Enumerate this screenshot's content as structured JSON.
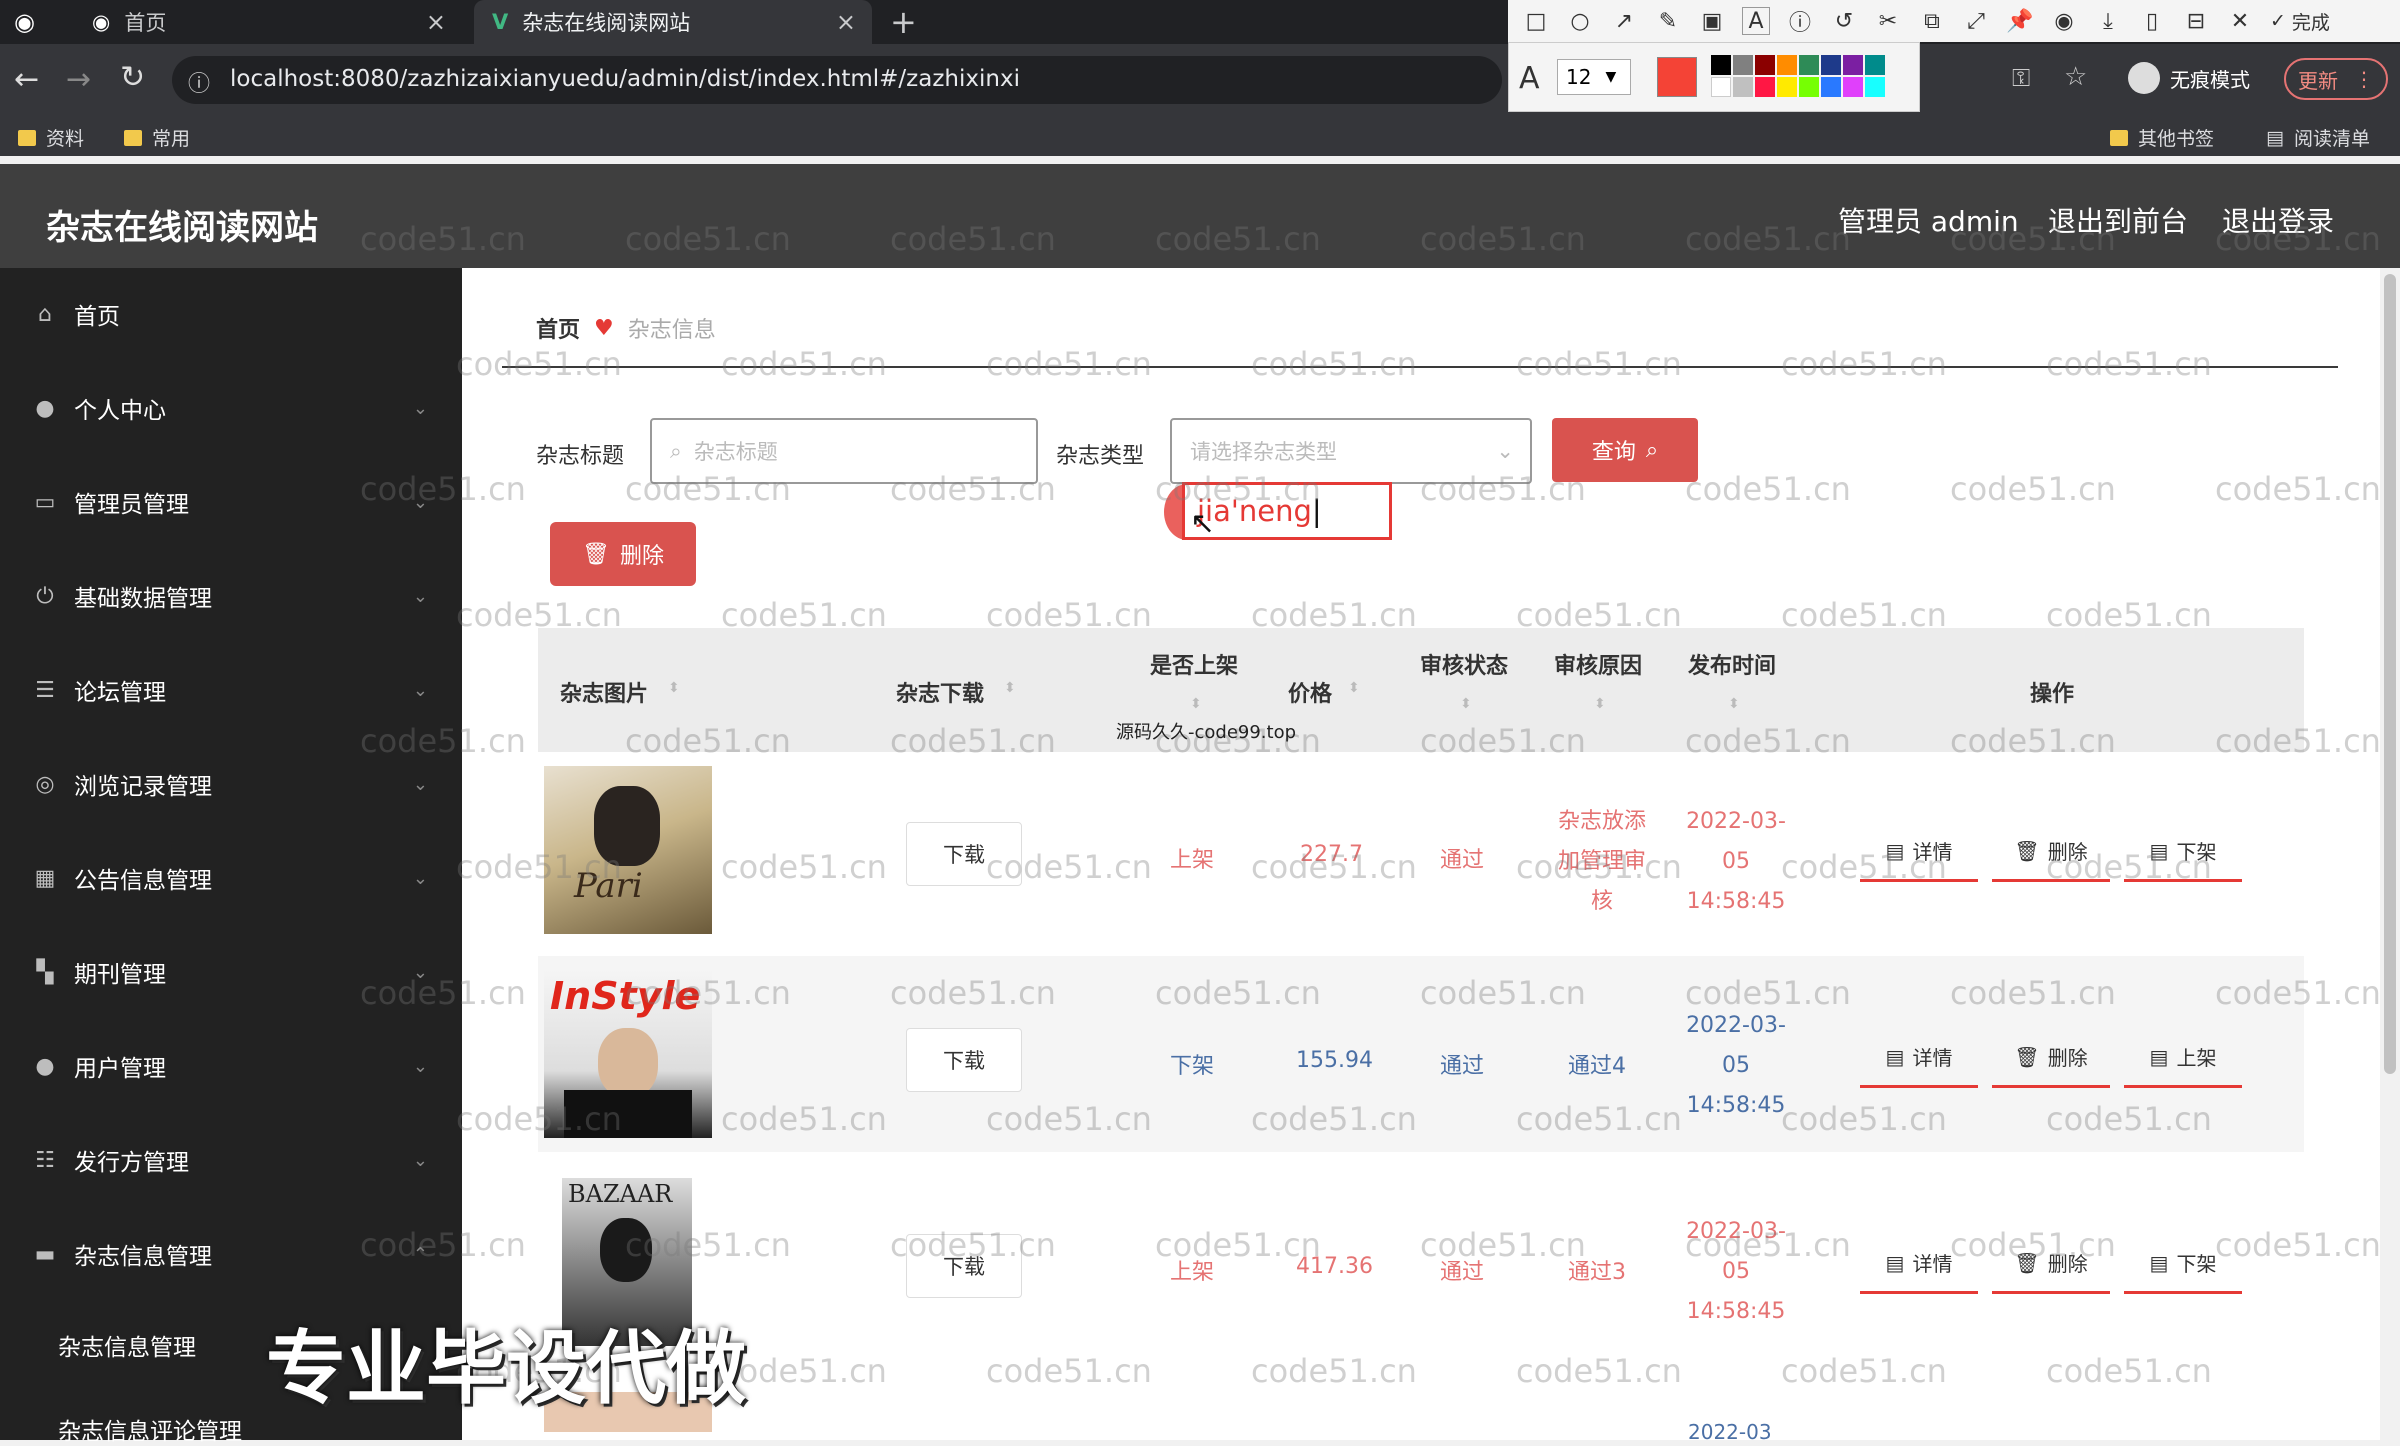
{
  "browser": {
    "tabs": [
      {
        "label": "首页",
        "active": false
      },
      {
        "label": "杂志在线阅读网站",
        "active": true
      }
    ],
    "url": "localhost:8080/zazhizaixianyuedu/admin/dist/index.html#/zazhixinxi",
    "bookmarks": [
      "资料",
      "常用"
    ],
    "bookmarks_right": [
      "其他书签",
      "阅读清单"
    ],
    "incognito_label": "无痕模式",
    "update_label": "更新",
    "annot_font_size": "12",
    "annot_done": "完成"
  },
  "header": {
    "title": "杂志在线阅读网站",
    "admin_label": "管理员 admin",
    "to_front": "退出到前台",
    "logout": "退出登录"
  },
  "sidebar": {
    "items": [
      {
        "label": "首页",
        "icon": "home-icon"
      },
      {
        "label": "个人中心",
        "icon": "user-icon"
      },
      {
        "label": "管理员管理",
        "icon": "admin-icon"
      },
      {
        "label": "基础数据管理",
        "icon": "power-icon"
      },
      {
        "label": "论坛管理",
        "icon": "list-icon"
      },
      {
        "label": "浏览记录管理",
        "icon": "circle-icon"
      },
      {
        "label": "公告信息管理",
        "icon": "grid-icon"
      },
      {
        "label": "期刊管理",
        "icon": "tiles-icon"
      },
      {
        "label": "用户管理",
        "icon": "pin-icon"
      },
      {
        "label": "发行方管理",
        "icon": "sliders-icon"
      },
      {
        "label": "杂志信息管理",
        "icon": "briefcase-icon"
      }
    ],
    "sub_items": [
      "杂志信息管理",
      "杂志信息评论管理"
    ]
  },
  "breadcrumb": {
    "home": "首页",
    "current": "杂志信息"
  },
  "search": {
    "title_label": "杂志标题",
    "title_placeholder": "杂志标题",
    "type_label": "杂志类型",
    "type_placeholder": "请选择杂志类型",
    "query_button": "查询",
    "delete_button": "删除",
    "ime_text": "jia'neng"
  },
  "table": {
    "headers": {
      "image": "杂志图片",
      "download": "杂志下载",
      "on_shelf": "是否上架",
      "price": "价格",
      "review_status": "审核状态",
      "review_reason": "审核原因",
      "publish_time": "发布时间",
      "actions": "操作"
    },
    "rows": [
      {
        "download": "下载",
        "shelf": "上架",
        "price": "227.7",
        "status": "通过",
        "reason": "杂志放添加管理审核",
        "time": "2022-03-05 14:58:45",
        "act_shelf": "下架",
        "color": "red"
      },
      {
        "download": "下载",
        "shelf": "下架",
        "price": "155.94",
        "status": "通过",
        "reason": "通过4",
        "time": "2022-03-05 14:58:45",
        "act_shelf": "上架",
        "color": "blue"
      },
      {
        "download": "下载",
        "shelf": "上架",
        "price": "417.36",
        "status": "通过",
        "reason": "通过3",
        "time": "2022-03-05 14:58:45",
        "act_shelf": "下架",
        "color": "red"
      }
    ],
    "action_detail": "详情",
    "action_delete": "删除",
    "next_row_time_partial": "2022-03"
  },
  "watermark": {
    "text": "code51.cn",
    "small": "源码久久-code99.top",
    "big": "专业毕设代做"
  },
  "colors": {
    "accent": "#d9534f",
    "sidebar_bg": "#222222",
    "header_bg": "#3f3f3f"
  }
}
